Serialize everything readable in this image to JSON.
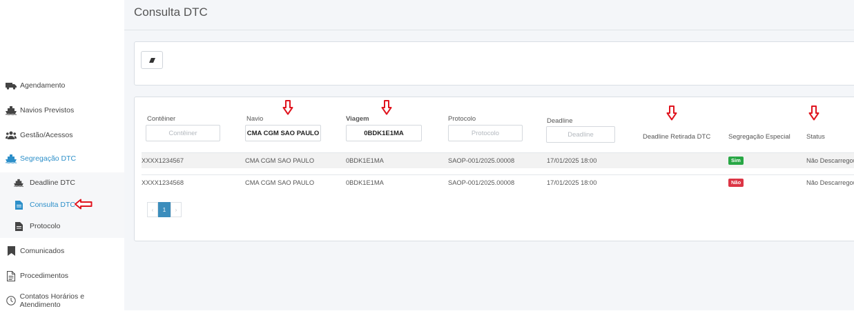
{
  "sidebar": {
    "items": [
      {
        "label": "Agendamento",
        "icon": "truck-icon"
      },
      {
        "label": "Navios Previstos",
        "icon": "ship-icon"
      },
      {
        "label": "Gestão/Acessos",
        "icon": "users-icon"
      },
      {
        "label": "Segregação DTC",
        "icon": "ship-icon"
      },
      {
        "label": "Deadline DTC",
        "icon": "ship-icon"
      },
      {
        "label": "Consulta DTC",
        "icon": "file-icon"
      },
      {
        "label": "Protocolo",
        "icon": "file-icon"
      },
      {
        "label": "Comunicados",
        "icon": "bookmark-icon"
      },
      {
        "label": "Procedimentos",
        "icon": "document-icon"
      },
      {
        "label": "Contatos Horários e Atendimento",
        "icon": "clock-icon"
      }
    ],
    "active_color": "#2c8fc9"
  },
  "page": {
    "title": "Consulta DTC"
  },
  "filters": {
    "conteiner": {
      "label": "Contêiner",
      "placeholder": "Contêiner",
      "value": ""
    },
    "navio": {
      "label": "Navio",
      "placeholder": "Navio",
      "value": "CMA CGM SAO PAULO"
    },
    "viagem": {
      "label": "Viagem",
      "placeholder": "Viagem",
      "value": "0BDK1E1MA"
    },
    "protocolo": {
      "label": "Protocolo",
      "placeholder": "Protocolo",
      "value": ""
    },
    "deadline": {
      "label": "Deadline",
      "placeholder": "Deadline",
      "value": ""
    }
  },
  "columns": {
    "deadline_retirada": "Deadline Retirada DTC",
    "segregacao": "Segregação Especial",
    "status": "Status"
  },
  "rows": [
    {
      "conteiner": "XXXX1234567",
      "navio": "CMA CGM SAO PAULO",
      "viagem": "0BDK1E1MA",
      "protocolo": "SAOP-001/2025.00008",
      "deadline": "17/01/2025 18:00",
      "deadline_retirada": "",
      "segregacao": "Sim",
      "status": "Não Descarregou"
    },
    {
      "conteiner": "XXXX1234568",
      "navio": "CMA CGM SAO PAULO",
      "viagem": "0BDK1E1MA",
      "protocolo": "SAOP-001/2025.00008",
      "deadline": "17/01/2025 18:00",
      "deadline_retirada": "",
      "segregacao": "Não",
      "status": "Não Descarregou"
    }
  ],
  "pagination": {
    "prev": "‹",
    "current": "1",
    "next": "›"
  },
  "colors": {
    "accent": "#2c8fc9",
    "annotation_red": "#e0141e",
    "badge_yes": "#28a745",
    "badge_no": "#dc3545"
  }
}
